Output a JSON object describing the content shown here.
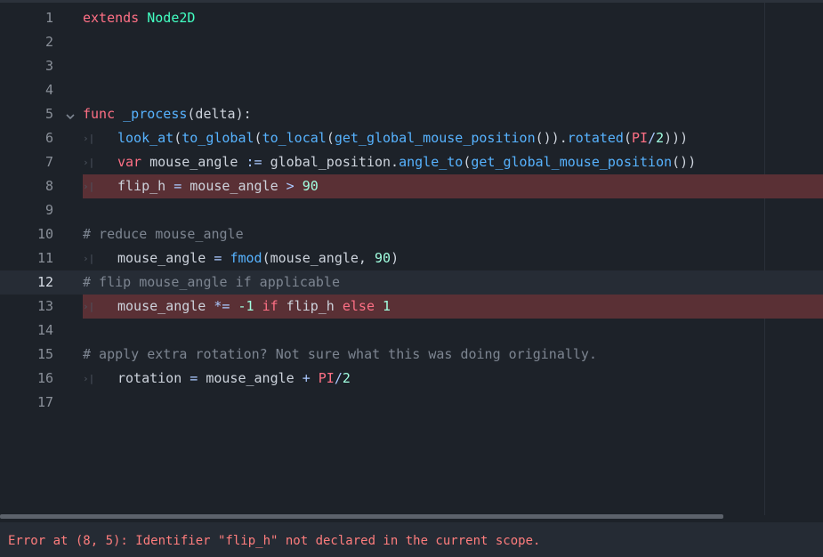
{
  "editor": {
    "lines": [
      {
        "num": "1"
      },
      {
        "num": "2"
      },
      {
        "num": "3"
      },
      {
        "num": "4"
      },
      {
        "num": "5"
      },
      {
        "num": "6"
      },
      {
        "num": "7"
      },
      {
        "num": "8"
      },
      {
        "num": "9"
      },
      {
        "num": "10"
      },
      {
        "num": "11"
      },
      {
        "num": "12"
      },
      {
        "num": "13"
      },
      {
        "num": "14"
      },
      {
        "num": "15"
      },
      {
        "num": "16"
      },
      {
        "num": "17"
      }
    ],
    "code": {
      "l1": {
        "a": "extends",
        "b": "Node2D"
      },
      "l5": {
        "a": "func",
        "b": "_process",
        "c": "(delta):"
      },
      "l6": {
        "a": "look_at",
        "b": "(",
        "c": "to_global",
        "d": "(",
        "e": "to_local",
        "f": "(",
        "g": "get_global_mouse_position",
        "h": "()).",
        "i": "rotated",
        "j": "(",
        "k": "PI",
        "l": "/",
        "m": "2",
        "n": ")))"
      },
      "l7": {
        "a": "var",
        "b": " mouse_angle ",
        "c": ":=",
        "d": " global_position.",
        "e": "angle_to",
        "f": "(",
        "g": "get_global_mouse_position",
        "h": "())"
      },
      "l8": {
        "a": "flip_h ",
        "b": "=",
        "c": " mouse_angle ",
        "d": ">",
        "e": " ",
        "f": "90"
      },
      "l10": {
        "a": "# reduce mouse_angle"
      },
      "l11": {
        "a": "mouse_angle ",
        "b": "=",
        "c": " ",
        "d": "fmod",
        "e": "(mouse_angle, ",
        "f": "90",
        "g": ")"
      },
      "l12": {
        "a": "# flip mouse_angle if applicable"
      },
      "l13": {
        "a": "mouse_angle ",
        "b": "*=",
        "c": " ",
        "d": "-1",
        "e": " ",
        "f": "if",
        "g": " flip_h ",
        "h": "else",
        "i": " ",
        "j": "1"
      },
      "l15": {
        "a": "# apply extra rotation? Not sure what this was doing originally."
      },
      "l16": {
        "a": "rotation ",
        "b": "=",
        "c": " mouse_angle ",
        "d": "+",
        "e": " ",
        "f": "PI",
        "g": "/",
        "h": "2"
      }
    },
    "tab_marker": "›|"
  },
  "status": {
    "error_message": "Error at (8, 5): Identifier \"flip_h\" not declared in the current scope."
  },
  "colors": {
    "background": "#1d2229",
    "error_line": "#5a3035",
    "keyword": "#ff7085",
    "function": "#57b3ff",
    "number": "#a1ffe0",
    "class": "#42ffc2",
    "comment": "#7d8591",
    "error_text": "#ff7d7d"
  }
}
